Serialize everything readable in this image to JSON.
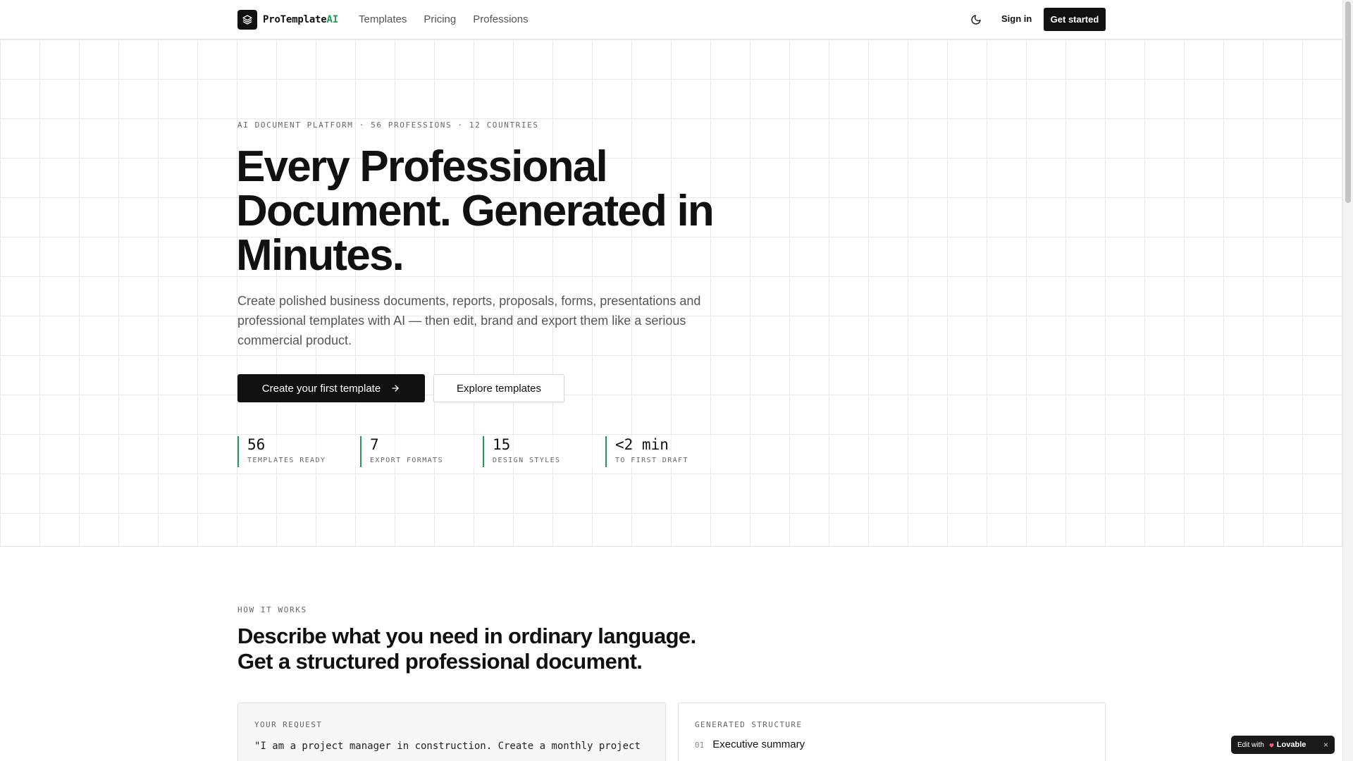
{
  "header": {
    "brand_prefix": "ProTemplate",
    "brand_suffix": "AI",
    "nav": [
      "Templates",
      "Pricing",
      "Professions"
    ],
    "theme_icon": "moon-icon",
    "sign_in": "Sign in",
    "get_started": "Get started"
  },
  "hero": {
    "eyebrow": "AI DOCUMENT PLATFORM · 56 PROFESSIONS · 12 COUNTRIES",
    "title": "Every Professional Document. Generated in Minutes.",
    "subtitle": "Create polished business documents, reports, proposals, forms, presentations and professional templates with AI — then edit, brand and export them like a serious commercial product.",
    "primary_cta": "Create your first template",
    "secondary_cta": "Explore templates",
    "stats": [
      {
        "value": "56",
        "label": "TEMPLATES READY"
      },
      {
        "value": "7",
        "label": "EXPORT FORMATS"
      },
      {
        "value": "15",
        "label": "DESIGN STYLES"
      },
      {
        "value": "<2 min",
        "label": "TO FIRST DRAFT"
      }
    ]
  },
  "how_it_works": {
    "eyebrow": "HOW IT WORKS",
    "title_line1": "Describe what you need in ordinary language.",
    "title_line2": "Get a structured professional document.",
    "request_label": "YOUR REQUEST",
    "request_text": "\"I am a project manager in construction. Create a monthly project",
    "structure_label": "GENERATED STRUCTURE",
    "structure_items": [
      {
        "num": "01",
        "text": "Executive summary"
      }
    ]
  },
  "badge": {
    "prefix": "Edit with",
    "brand": "Lovable",
    "close": "×"
  },
  "colors": {
    "accent": "#1f9d55",
    "primary": "#111111"
  }
}
